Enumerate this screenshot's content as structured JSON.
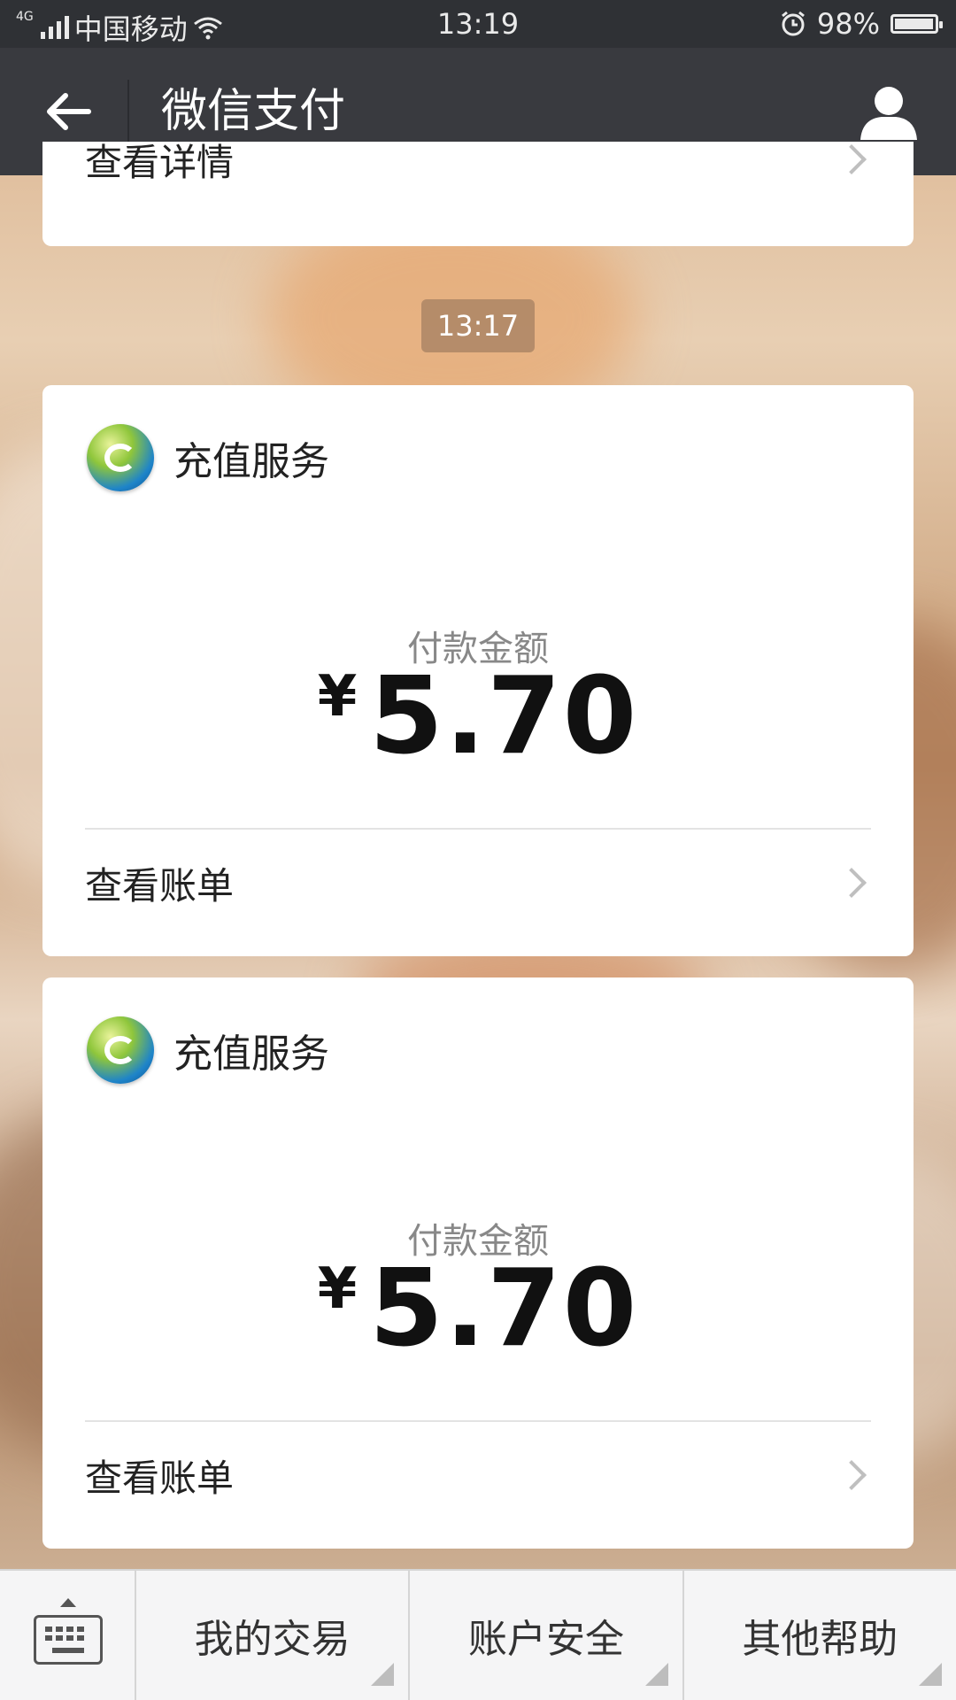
{
  "status_bar": {
    "network": "4G",
    "carrier": "中国移动",
    "time": "13:19",
    "battery": "98%",
    "battery_level": 0.98
  },
  "header": {
    "title": "微信支付"
  },
  "partial_card": {
    "row_label": "查看详情"
  },
  "timestamp": "13:17",
  "messages": [
    {
      "merchant": "充值服务",
      "amount_label": "付款金额",
      "currency": "¥",
      "amount": "5.70",
      "link_label": "查看账单"
    },
    {
      "merchant": "充值服务",
      "amount_label": "付款金额",
      "currency": "¥",
      "amount": "5.70",
      "link_label": "查看账单"
    }
  ],
  "bottom_menu": {
    "items": [
      "我的交易",
      "账户安全",
      "其他帮助"
    ]
  },
  "icons": {
    "back": "arrow-left-icon",
    "profile": "person-icon",
    "keyboard": "keyboard-icon",
    "chevron": "chevron-right-icon",
    "alarm": "alarm-icon",
    "wifi": "wifi-icon"
  },
  "colors": {
    "status_bar": "#2f3135",
    "title_bar": "#393a3f",
    "card": "#ffffff",
    "bottom_bar": "#f5f5f6"
  }
}
